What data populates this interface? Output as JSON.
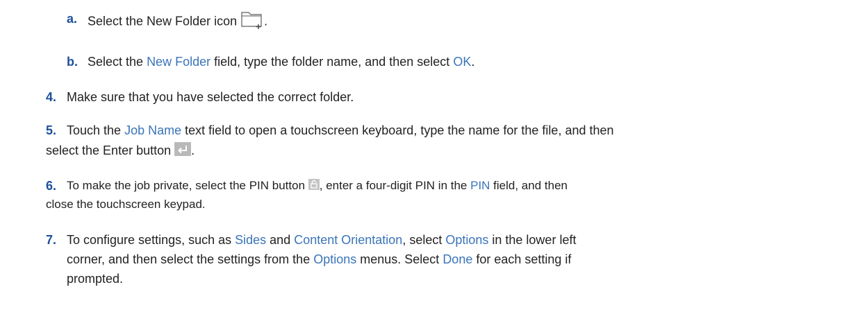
{
  "colors": {
    "text": "#222222",
    "step_number": "#1b4f9c",
    "link": "#3a74b8"
  },
  "steps": [
    {
      "number": "a.",
      "parts": [
        "Select the New Folder icon",
        "."
      ],
      "icon": "new-folder-icon"
    },
    {
      "number": "b.",
      "parts": [
        "Select the ",
        "New Folder",
        " field, type the folder name, and then select ",
        "OK",
        "."
      ]
    },
    {
      "number": "4.",
      "text": "Make sure that you have selected the correct folder."
    },
    {
      "number": "5.",
      "line1": [
        "Touch the ",
        "Job Name",
        " text field to open a touchscreen keyboard, type the name for the file, and then"
      ],
      "line2": [
        "select the Enter button",
        "."
      ],
      "icon": "enter-icon"
    },
    {
      "number": "6.",
      "line1": [
        "To make the job private, select the PIN button",
        ", enter a four-digit PIN in the ",
        "PIN",
        " field, and then"
      ],
      "line2": "close the touchscreen keypad.",
      "icon": "pin-lock-icon"
    },
    {
      "number": "7.",
      "line1": [
        "To configure settings, such as ",
        "Sides",
        " and ",
        "Content Orientation",
        ", select ",
        "Options",
        " in the lower left"
      ],
      "line2": [
        "corner, and then select the settings from the ",
        "Options",
        " menus. Select ",
        "Done",
        " for each setting if"
      ],
      "line3": "prompted."
    }
  ]
}
